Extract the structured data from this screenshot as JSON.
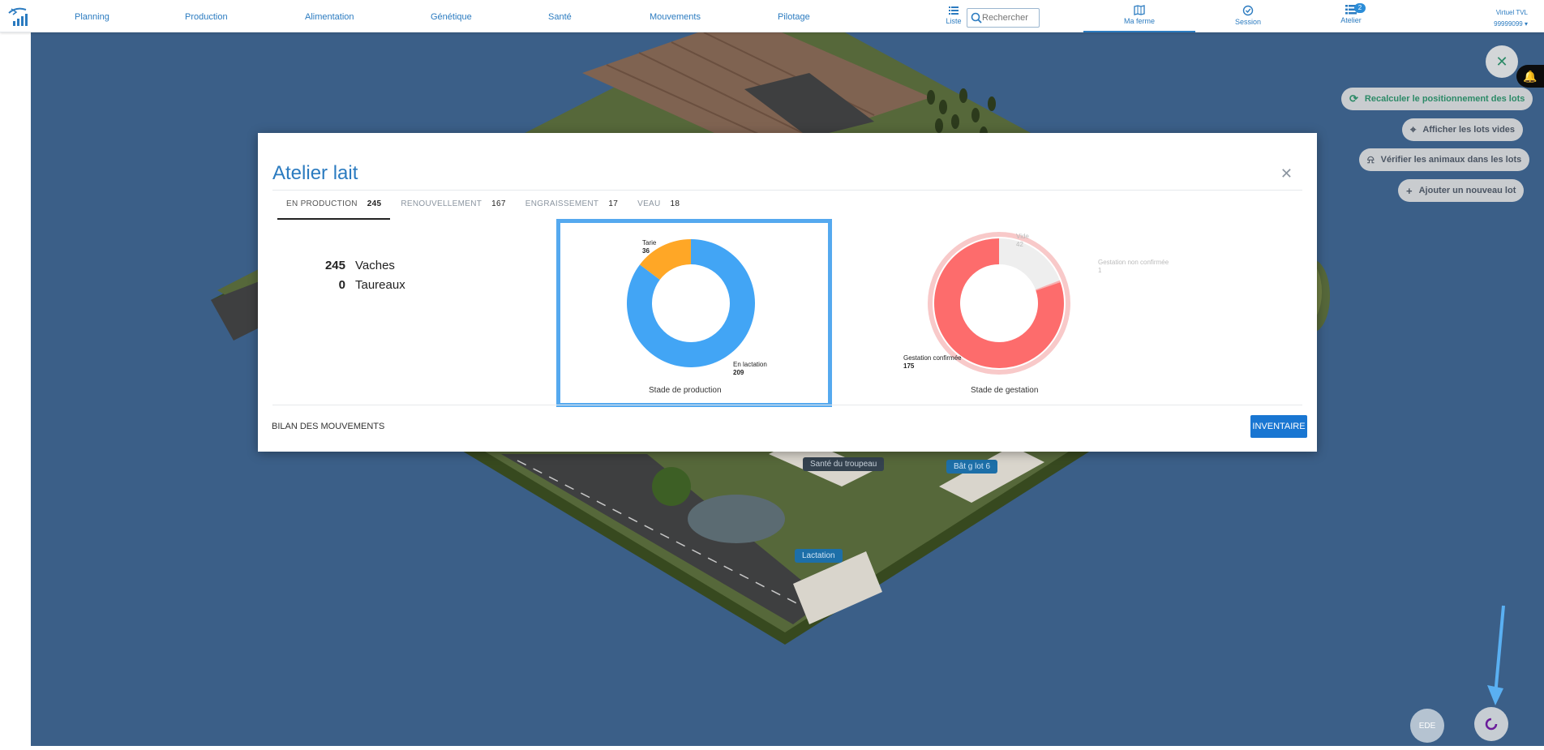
{
  "nav": {
    "items": [
      "Planning",
      "Production",
      "Alimentation",
      "Génétique",
      "Santé",
      "Mouvements",
      "Pilotage"
    ],
    "liste_label": "Liste",
    "search_placeholder": "Rechercher",
    "tabs": [
      {
        "label": "Ma ferme",
        "icon": "map-icon",
        "active": true
      },
      {
        "label": "Session",
        "icon": "session-check-icon",
        "active": false
      },
      {
        "label": "Atelier",
        "icon": "list-icon",
        "active": false,
        "badge": "2"
      }
    ],
    "user": {
      "name": "Virtuel TVL",
      "id": "99999099"
    }
  },
  "map_actions": {
    "recalculate": "Recalculer le positionnement des lots",
    "show_empty": "Afficher les lots vides",
    "check_animals": "Vérifier les animaux dans les lots",
    "add_lot": "Ajouter un nouveau lot",
    "ede": "EDE"
  },
  "map_labels": {
    "sante": "Santé du troupeau",
    "bat": "Bât g lot 6",
    "lactation": "Lactation"
  },
  "modal": {
    "title": "Atelier lait",
    "tabs": [
      {
        "label": "EN PRODUCTION",
        "count": "245"
      },
      {
        "label": "RENOUVELLEMENT",
        "count": "167"
      },
      {
        "label": "ENGRAISSEMENT",
        "count": "17"
      },
      {
        "label": "VEAU",
        "count": "18"
      }
    ],
    "stats": [
      {
        "value": "245",
        "label": "Vaches"
      },
      {
        "value": "0",
        "label": "Taureaux"
      }
    ],
    "footer_link": "BILAN DES MOUVEMENTS",
    "inventory_button": "INVENTAIRE"
  },
  "chart_data": [
    {
      "type": "pie",
      "title": "Stade de production",
      "categories": [
        "En lactation",
        "Tarie"
      ],
      "values": [
        209,
        36
      ],
      "colors": [
        "#42a5f5",
        "#ffa726"
      ],
      "labels": [
        {
          "name": "Tarie",
          "value": "36"
        },
        {
          "name": "En lactation",
          "value": "209"
        }
      ]
    },
    {
      "type": "pie",
      "title": "Stade de gestation",
      "categories": [
        "Gestation confirmée",
        "Vide",
        "Gestation non confirmée"
      ],
      "values": [
        175,
        42,
        1
      ],
      "colors": [
        "#fd6c6c",
        "#eeeeee",
        "#f7b0b0"
      ],
      "labels": [
        {
          "name": "Vide",
          "value": "42"
        },
        {
          "name": "Gestation non confirmée",
          "value": "1"
        },
        {
          "name": "Gestation confirmée",
          "value": "175"
        }
      ]
    }
  ]
}
